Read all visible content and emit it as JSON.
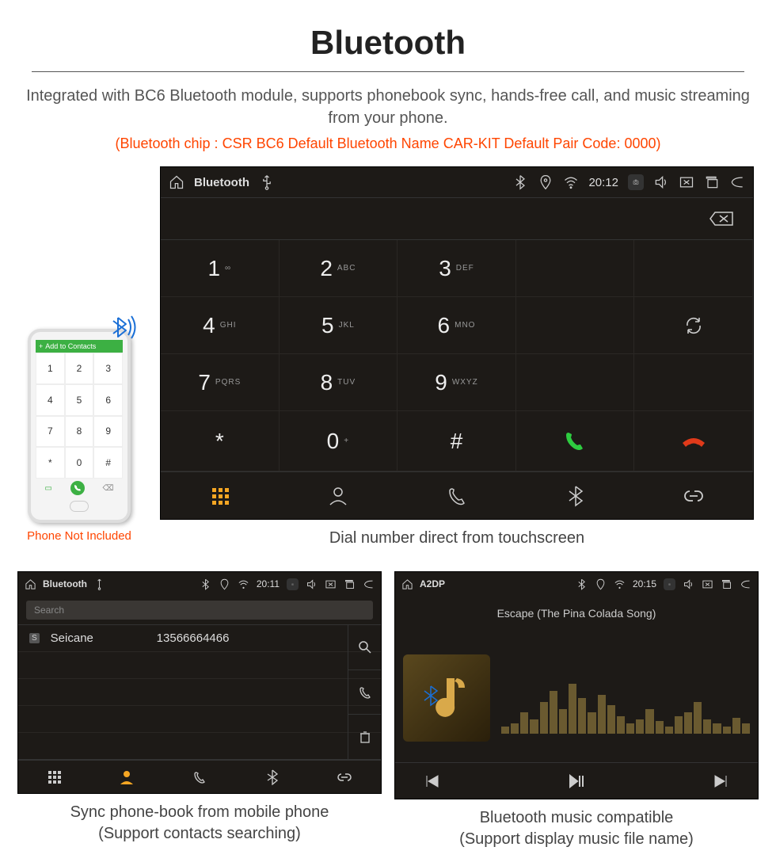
{
  "title": "Bluetooth",
  "description": "Integrated with BC6 Bluetooth module, supports phonebook sync, hands-free call, and music streaming from your phone.",
  "specs": "(Bluetooth chip : CSR BC6     Default Bluetooth Name CAR-KIT     Default Pair Code: 0000)",
  "phone_note": "Phone Not Included",
  "phone_mock_header": "Add to Contacts",
  "caption_main": "Dial number direct from touchscreen",
  "caption_left": "Sync phone-book from mobile phone\n(Support contacts searching)",
  "caption_right": "Bluetooth music compatible\n(Support display music file name)",
  "main_screen": {
    "app": "Bluetooth",
    "time": "20:12",
    "keys": [
      {
        "d": "1",
        "l": "∞"
      },
      {
        "d": "2",
        "l": "ABC"
      },
      {
        "d": "3",
        "l": "DEF"
      },
      {
        "d": "4",
        "l": "GHI"
      },
      {
        "d": "5",
        "l": "JKL"
      },
      {
        "d": "6",
        "l": "MNO"
      },
      {
        "d": "7",
        "l": "PQRS"
      },
      {
        "d": "8",
        "l": "TUV"
      },
      {
        "d": "9",
        "l": "WXYZ"
      },
      {
        "d": "*",
        "l": ""
      },
      {
        "d": "0",
        "l": "+"
      },
      {
        "d": "#",
        "l": ""
      }
    ]
  },
  "pb_screen": {
    "app": "Bluetooth",
    "time": "20:11",
    "search_ph": "Search",
    "contact_name": "Seicane",
    "contact_number": "13566664466"
  },
  "music_screen": {
    "app": "A2DP",
    "time": "20:15",
    "song": "Escape (The Pina Colada Song)"
  }
}
